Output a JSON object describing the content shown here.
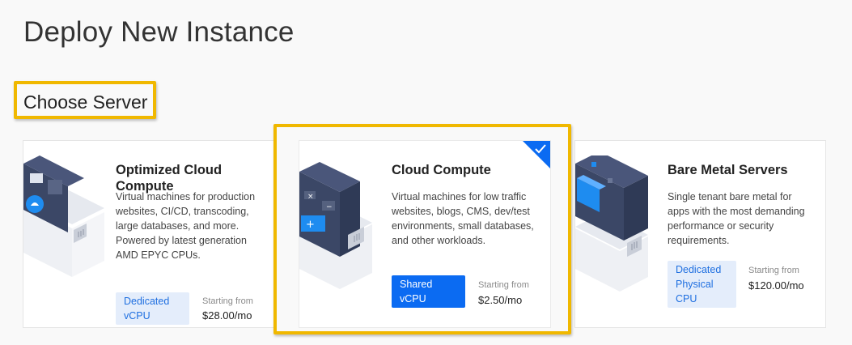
{
  "page": {
    "title": "Deploy New Instance",
    "section_title": "Choose Server"
  },
  "colors": {
    "accent": "#0b6bf2",
    "highlight": "#f0b800",
    "badge_light": "#e4edfb"
  },
  "cards": [
    {
      "name": "Optimized Cloud Compute",
      "description": "Virtual machines for production websites, CI/CD, transcoding, large databases, and more. Powered by latest generation AMD EPYC CPUs.",
      "badge": "Dedicated vCPU",
      "price_label": "Starting from",
      "price": "$28.00/mo",
      "selected": false
    },
    {
      "name": "Cloud Compute",
      "description": "Virtual machines for low traffic websites, blogs, CMS, dev/test environments, small databases, and other workloads.",
      "badge": "Shared vCPU",
      "price_label": "Starting from",
      "price": "$2.50/mo",
      "selected": true
    },
    {
      "name": "Bare Metal Servers",
      "description": "Single tenant bare metal for apps with the most demanding performance or security requirements.",
      "badge": "Dedicated Physical CPU",
      "price_label": "Starting from",
      "price": "$120.00/mo",
      "selected": false
    }
  ],
  "icons": {
    "selected_check": "check-icon"
  }
}
